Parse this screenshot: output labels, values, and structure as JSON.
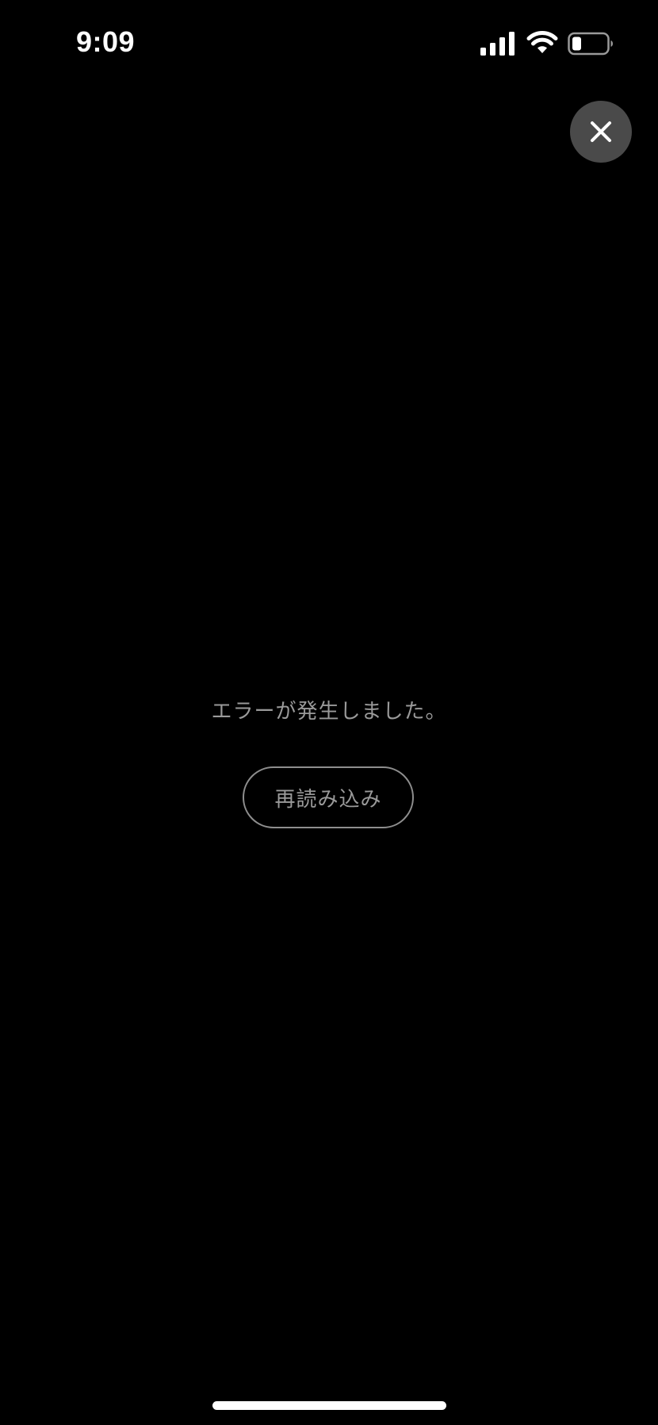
{
  "status_bar": {
    "time": "9:09",
    "icons": [
      "signal-icon",
      "wifi-icon",
      "battery-icon"
    ]
  },
  "close_button": {
    "icon": "close-icon",
    "background": "#4a4a4a"
  },
  "error": {
    "message": "エラーが発生しました。"
  },
  "reload_button": {
    "label": "再読み込み"
  },
  "colors": {
    "background": "#000000",
    "text_muted": "#9a9a9a",
    "outline": "#8e8e8e"
  }
}
